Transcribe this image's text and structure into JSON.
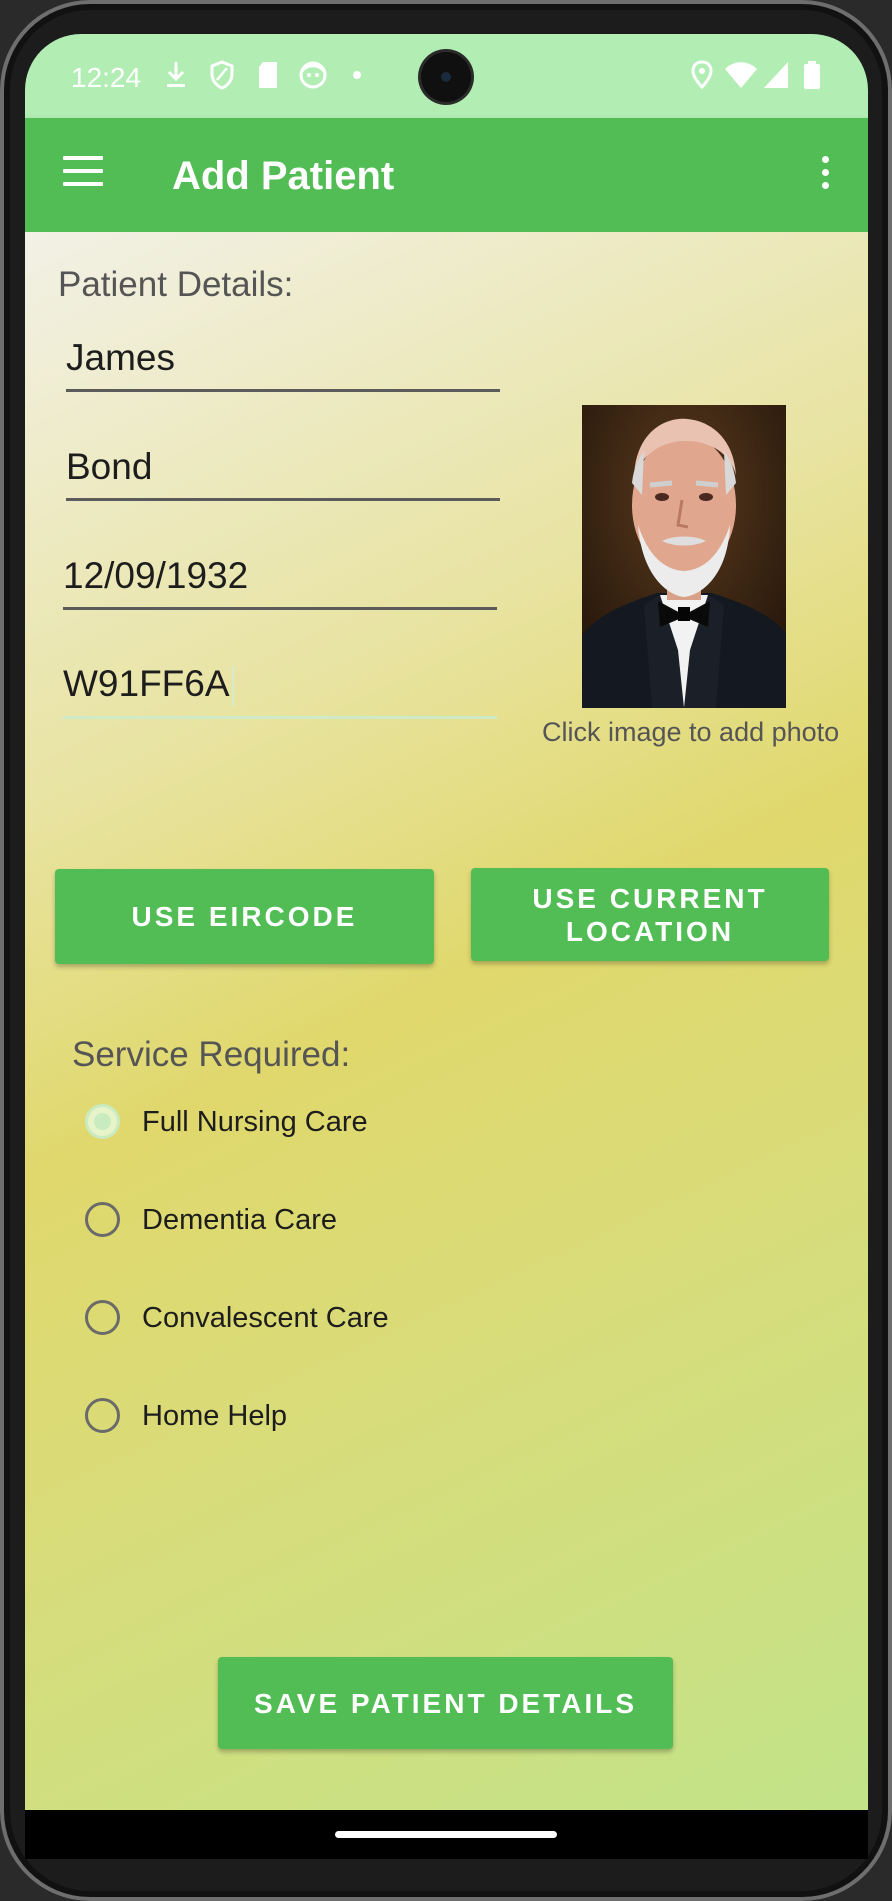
{
  "status_bar": {
    "time": "12:24",
    "left_icons": [
      "download-icon",
      "shield-icon",
      "sd-card-icon",
      "face-icon",
      "dot-icon"
    ],
    "right_icons": [
      "location-icon",
      "wifi-icon",
      "signal-icon",
      "battery-icon"
    ]
  },
  "app_bar": {
    "title": "Add Patient",
    "menu_icon": "hamburger-menu-icon",
    "overflow_icon": "more-vert-icon"
  },
  "patient_details": {
    "label": "Patient Details:",
    "first_name": "James",
    "last_name": "Bond",
    "date_of_birth": "12/09/1932",
    "eircode": "W91FF6A"
  },
  "photo": {
    "caption": "Click image to add photo"
  },
  "buttons": {
    "use_eircode": "USE EIRCODE",
    "use_current_location_line1": "USE CURRENT",
    "use_current_location_line2": "LOCATION",
    "save": "SAVE PATIENT DETAILS"
  },
  "service": {
    "label": "Service Required:",
    "options": [
      {
        "label": "Full Nursing Care",
        "selected": true
      },
      {
        "label": "Dementia Care",
        "selected": false
      },
      {
        "label": "Convalescent Care",
        "selected": false
      },
      {
        "label": "Home Help",
        "selected": false
      }
    ]
  },
  "colors": {
    "primary": "#52bc55",
    "status_bar": "#b2eeb4"
  }
}
